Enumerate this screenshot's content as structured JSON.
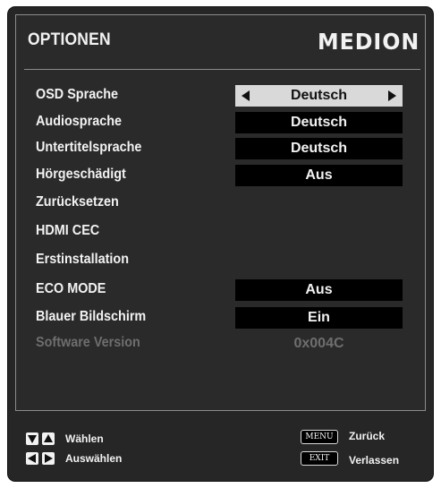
{
  "header": {
    "title": "OPTIONEN",
    "brand": "MEDION"
  },
  "menu": {
    "items": [
      {
        "label": "OSD Sprache",
        "value": "Deutsch"
      },
      {
        "label": "Audiosprache",
        "value": "Deutsch"
      },
      {
        "label": "Untertitelsprache",
        "value": "Deutsch"
      },
      {
        "label": "Hörgeschädigt",
        "value": "Aus"
      },
      {
        "label": "Zurücksetzen"
      },
      {
        "label": "HDMI CEC"
      },
      {
        "label": "Erstinstallation"
      },
      {
        "label": "ECO MODE",
        "value": "Aus"
      },
      {
        "label": "Blauer Bildschirm",
        "value": "Ein"
      },
      {
        "label": "Software Version",
        "value": "0x004C"
      }
    ]
  },
  "footer": {
    "select": "Wählen",
    "choose": "Auswählen",
    "menu_key": "MENU",
    "back": "Zurück",
    "exit_key": "EXIT",
    "leave": "Verlassen"
  },
  "colors": {
    "background": "#262626",
    "selected_value_bg": "#d9d9d9",
    "value_bg": "#000000",
    "disabled_text": "#6e6e6e"
  },
  "icons": {
    "up_down": "up-down-arrow-keys-icon",
    "left_right": "left-right-arrow-keys-icon",
    "value_prev": "left-arrow-icon",
    "value_next": "right-arrow-icon"
  }
}
